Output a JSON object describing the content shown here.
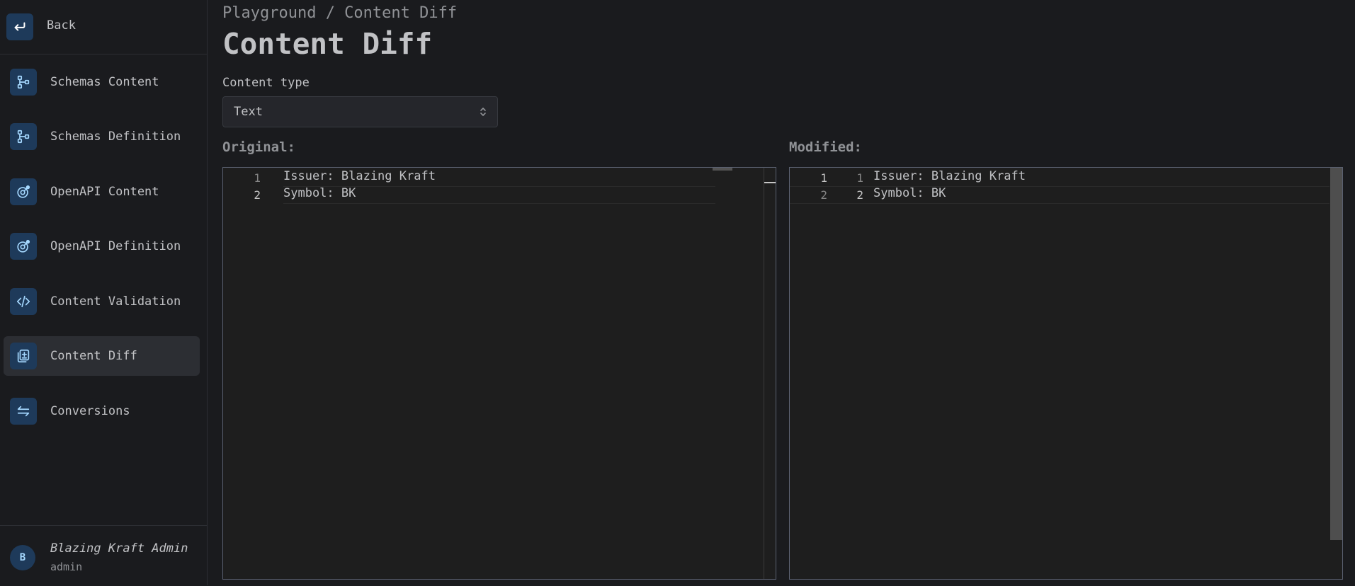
{
  "sidebar": {
    "back_label": "Back",
    "items": [
      {
        "label": "Schemas Content",
        "icon": "schema-icon"
      },
      {
        "label": "Schemas Definition",
        "icon": "schema-icon"
      },
      {
        "label": "OpenAPI Content",
        "icon": "openapi-icon"
      },
      {
        "label": "OpenAPI Definition",
        "icon": "openapi-icon"
      },
      {
        "label": "Content Validation",
        "icon": "code-icon"
      },
      {
        "label": "Content Diff",
        "icon": "diff-icon"
      },
      {
        "label": "Conversions",
        "icon": "arrows-swap-icon"
      }
    ],
    "active_item": "Content Diff",
    "user": {
      "initial": "B",
      "name": "Blazing Kraft Admin",
      "role": "admin"
    }
  },
  "header": {
    "breadcrumb": "Playground / Content Diff",
    "title": "Content Diff"
  },
  "content_type": {
    "label": "Content type",
    "value": "Text"
  },
  "original": {
    "label": "Original:",
    "lines": [
      {
        "num": "1",
        "text": "Issuer: Blazing Kraft"
      },
      {
        "num": "2",
        "text": "Symbol: BK"
      }
    ]
  },
  "modified": {
    "label": "Modified:",
    "lines": [
      {
        "orig_num": "1",
        "num": "1",
        "text": "Issuer: Blazing Kraft"
      },
      {
        "orig_num": "2",
        "num": "2",
        "text": "Symbol: BK"
      }
    ]
  },
  "colors": {
    "accent": "#a5d8ff",
    "icon_bg": "#1e3a5a",
    "background": "#1a1b1e",
    "editor_bg": "#1e1e1e"
  }
}
